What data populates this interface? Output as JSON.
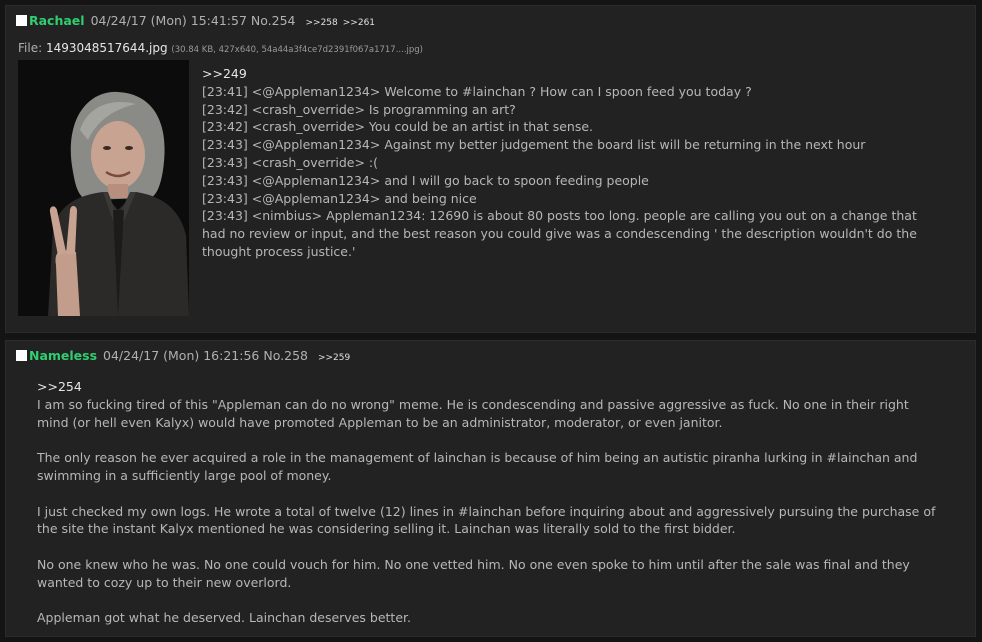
{
  "posts": [
    {
      "name": "Rachael",
      "date": "04/24/17 (Mon) 15:41:57",
      "number": "No.254",
      "backlinks": [
        ">>258",
        ">>261"
      ],
      "file": {
        "label": "File:",
        "filename": "1493048517644.jpg",
        "meta": "(30.84 KB, 427x640, 54a44a3f4ce7d2391f067a1717....jpg)"
      },
      "lines": [
        ">>249",
        "[23:41] <@Appleman1234> Welcome to #lainchan ? How can I spoon feed you today ?",
        "[23:42] <crash_override> Is programming an art?",
        "[23:42] <crash_override> You could be an artist in that sense.",
        "[23:43] <@Appleman1234> Against my better judgement the board list will be returning in the next hour",
        "[23:43] <crash_override> :(",
        "[23:43] <@Appleman1234> and I will go back to spoon feeding people",
        "[23:43] <@Appleman1234> and being nice",
        "[23:43] <nimbius> Appleman1234: 12690 is about 80 posts too long.  people are calling you out on a change that had no review or input, and the best reason you could give was a condescending ' the description wouldn't do the thought process justice.'"
      ]
    },
    {
      "name": "Nameless",
      "date": "04/24/17 (Mon) 16:21:56",
      "number": "No.258",
      "backlinks": [
        ">>259"
      ],
      "lines": [
        ">>254",
        "I am so fucking tired of this \"Appleman can do no wrong\" meme. He is condescending and passive aggressive as fuck. No one in their right mind (or hell even Kalyx) would have promoted Appleman to be an administrator, moderator, or even janitor.",
        "The only reason he ever acquired a role in the management of lainchan is because of him being an autistic piranha lurking in #lainchan and swimming in a sufficiently large pool of money.",
        "I just checked my own logs. He wrote a total of twelve (12) lines in #lainchan before inquiring about and aggressively pursuing the purchase of the site the instant Kalyx mentioned he was considering selling it. Lainchan was literally sold to the first bidder.",
        "No one knew who he was. No one could vouch for him. No one vetted him. No one even spoke to him until after the sale was final and they wanted to cozy up to their new overlord.",
        "Appleman got what he deserved. Lainchan deserves better."
      ]
    }
  ]
}
